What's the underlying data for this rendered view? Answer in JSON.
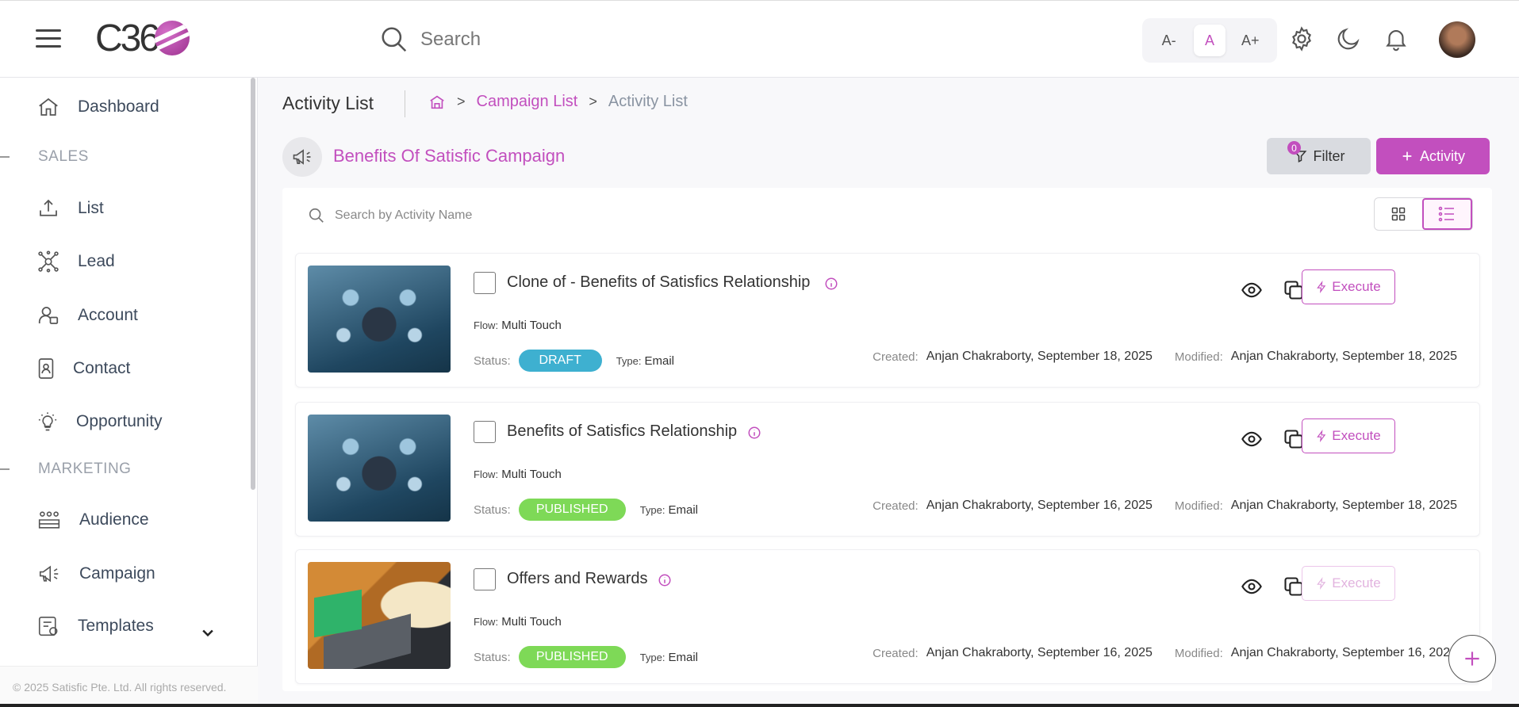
{
  "header": {
    "logo_text": "C36",
    "search_placeholder": "Search",
    "font_controls": [
      "A-",
      "A",
      "A+"
    ]
  },
  "sidebar": {
    "items": [
      {
        "label": "Dashboard",
        "icon": "home-icon"
      },
      {
        "section": "SALES"
      },
      {
        "label": "List",
        "icon": "upload-icon"
      },
      {
        "label": "Lead",
        "icon": "lead-network-icon"
      },
      {
        "label": "Account",
        "icon": "account-icon"
      },
      {
        "label": "Contact",
        "icon": "contact-icon"
      },
      {
        "label": "Opportunity",
        "icon": "lightbulb-icon"
      },
      {
        "section": "MARKETING"
      },
      {
        "label": "Audience",
        "icon": "audience-icon"
      },
      {
        "label": "Campaign",
        "icon": "megaphone-icon"
      },
      {
        "label": "Templates",
        "icon": "templates-icon"
      }
    ],
    "footer": "© 2025 Satisfic Pte. Ltd. All rights reserved."
  },
  "page": {
    "title": "Activity List",
    "breadcrumb": [
      "Campaign List",
      "Activity List"
    ],
    "campaign_name": "Benefits Of Satisfic Campaign",
    "filter_label": "Filter",
    "filter_count": "0",
    "add_activity_label": "Activity",
    "search_placeholder": "Search by Activity Name"
  },
  "labels": {
    "flow": "Flow:",
    "status": "Status:",
    "type": "Type:",
    "created": "Created:",
    "modified": "Modified:",
    "execute": "Execute"
  },
  "activities": [
    {
      "title": "Clone of - Benefits of Satisfics Relationship",
      "flow": "Multi Touch",
      "status": "DRAFT",
      "type": "Email",
      "created": "Anjan Chakraborty, September 18, 2025",
      "modified": "Anjan Chakraborty, September 18, 2025",
      "execute_enabled": true
    },
    {
      "title": "Benefits of Satisfics Relationship",
      "flow": "Multi Touch",
      "status": "PUBLISHED",
      "type": "Email",
      "created": "Anjan Chakraborty, September 16, 2025",
      "modified": "Anjan Chakraborty, September 18, 2025",
      "execute_enabled": true
    },
    {
      "title": "Offers and Rewards",
      "flow": "Multi Touch",
      "status": "PUBLISHED",
      "type": "Email",
      "created": "Anjan Chakraborty, September 16, 2025",
      "modified": "Anjan Chakraborty, September 16, 2025",
      "execute_enabled": false
    }
  ],
  "colors": {
    "accent": "#c24fbe",
    "draft": "#3eb0d0",
    "published": "#7ed957"
  }
}
